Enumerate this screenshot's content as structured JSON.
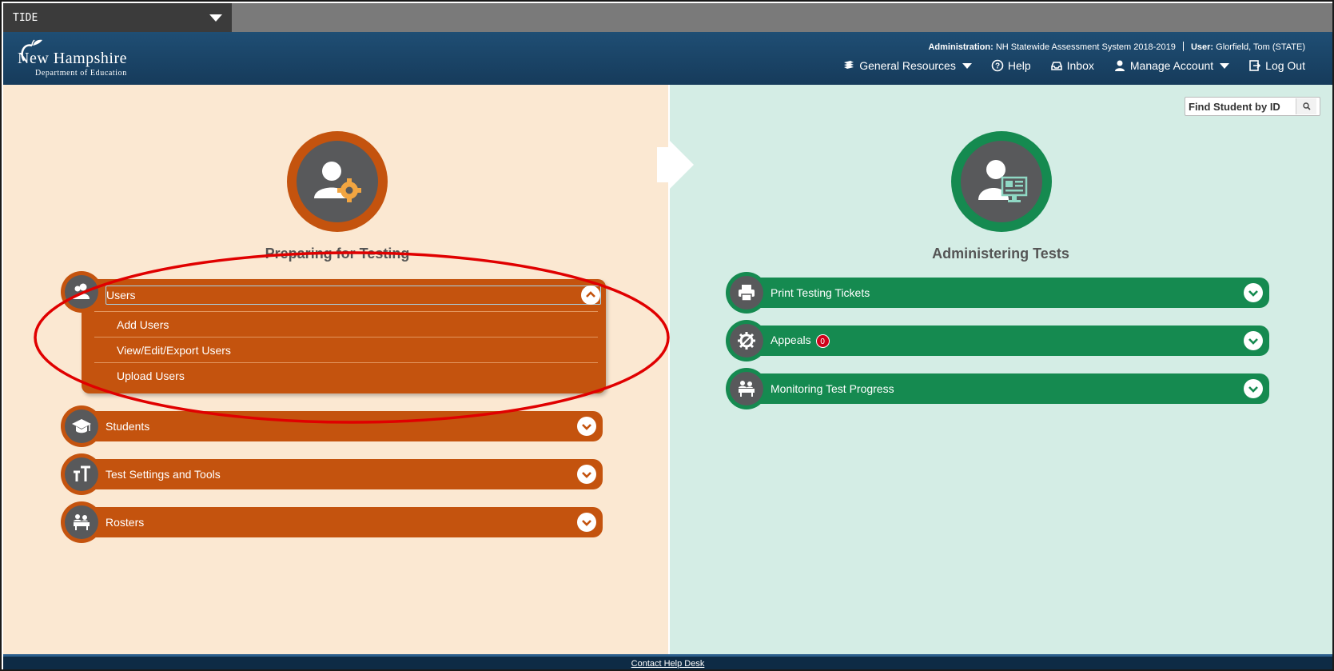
{
  "app": {
    "selector_label": "TIDE"
  },
  "header": {
    "logo": {
      "line1": "New Hampshire",
      "line2": "Department of Education"
    },
    "administration_label": "Administration:",
    "administration_value": "NH Statewide Assessment System 2018-2019",
    "user_label": "User:",
    "user_value": "Glorfield, Tom (STATE)",
    "nav": {
      "general_resources": "General Resources",
      "help": "Help",
      "inbox": "Inbox",
      "manage_account": "Manage Account",
      "log_out": "Log Out"
    }
  },
  "search": {
    "placeholder": "Find Student by ID"
  },
  "left": {
    "title": "Preparing for Testing",
    "users": {
      "label": "Users",
      "items": [
        "Add Users",
        "View/Edit/Export Users",
        "Upload Users"
      ]
    },
    "sections": [
      "Students",
      "Test Settings and Tools",
      "Rosters"
    ]
  },
  "right": {
    "title": "Administering Tests",
    "sections": [
      "Print Testing Tickets",
      "Appeals",
      "Monitoring Test Progress"
    ],
    "appeals_badge": "0"
  },
  "footer": {
    "help_link": "Contact Help Desk"
  },
  "colors": {
    "orange": "#c4530e",
    "green": "#158a50",
    "annotation": "#e00000"
  }
}
